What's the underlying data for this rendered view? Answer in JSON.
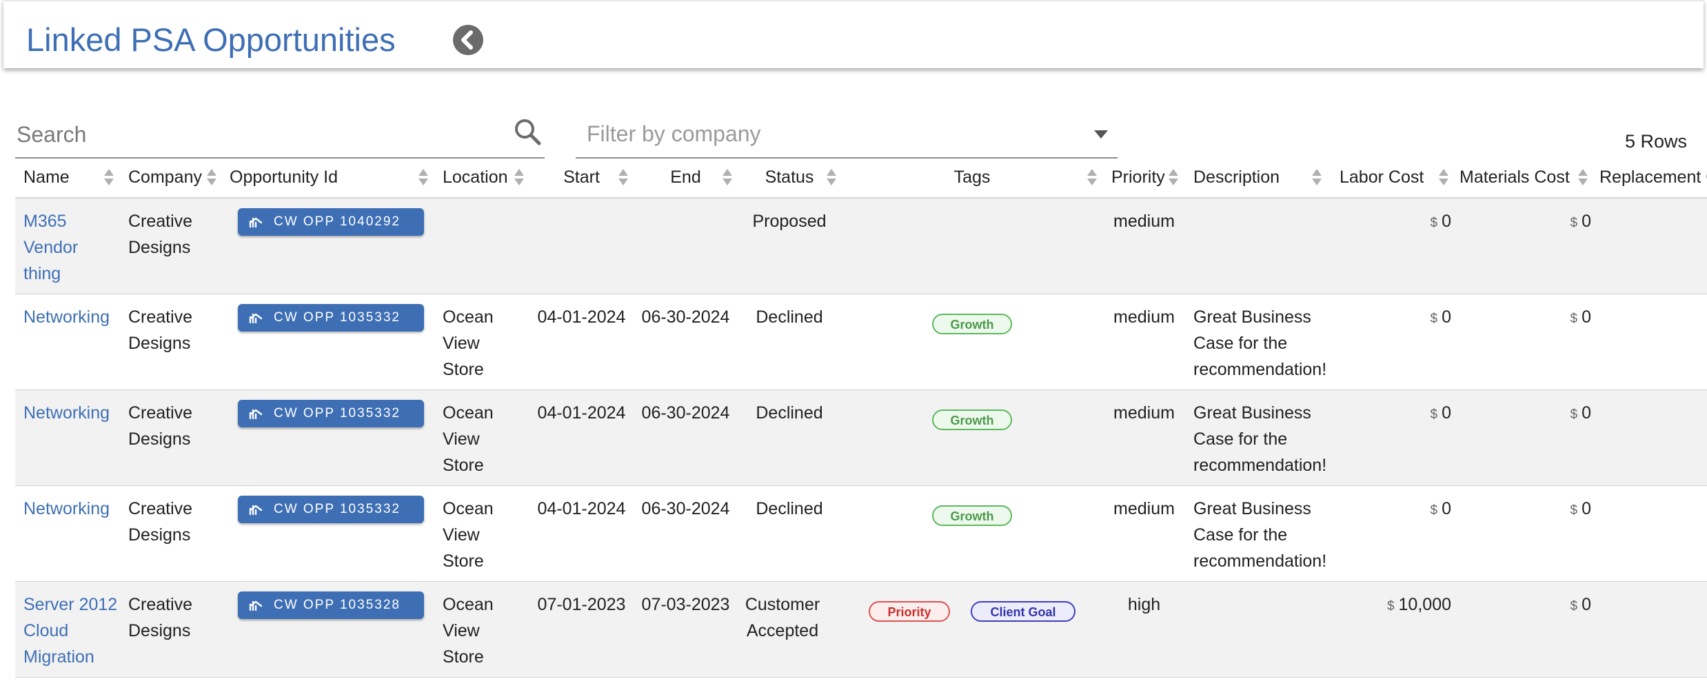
{
  "header": {
    "title": "Linked PSA Opportunities"
  },
  "search": {
    "placeholder": "Search",
    "value": ""
  },
  "filter": {
    "placeholder": "Filter by company"
  },
  "rows_count": "5 Rows",
  "columns": {
    "name": "Name",
    "company": "Company",
    "opportunity_id": "Opportunity Id",
    "location": "Location",
    "start": "Start",
    "end": "End",
    "status": "Status",
    "tags": "Tags",
    "priority": "Priority",
    "description": "Description",
    "labor_cost": "Labor Cost",
    "materials_cost": "Materials Cost",
    "replacement_cost": "Replacement Co"
  },
  "currency_symbol": "$",
  "rows": [
    {
      "name": "M365 Vendor thing",
      "company": "Creative Designs",
      "opportunity": "CW OPP 1040292",
      "location": "",
      "start": "",
      "end": "",
      "status": "Proposed",
      "tags": [],
      "priority": "medium",
      "description": "",
      "labor_cost": "0",
      "materials_cost": "0"
    },
    {
      "name": "Networking",
      "company": "Creative Designs",
      "opportunity": "CW OPP 1035332",
      "location": "Ocean View Store",
      "start": "04-01-2024",
      "end": "06-30-2024",
      "status": "Declined",
      "tags": [
        "Growth"
      ],
      "priority": "medium",
      "description": "Great Business Case for the recommendation!",
      "labor_cost": "0",
      "materials_cost": "0"
    },
    {
      "name": "Networking",
      "company": "Creative Designs",
      "opportunity": "CW OPP 1035332",
      "location": "Ocean View Store",
      "start": "04-01-2024",
      "end": "06-30-2024",
      "status": "Declined",
      "tags": [
        "Growth"
      ],
      "priority": "medium",
      "description": "Great Business Case for the recommendation!",
      "labor_cost": "0",
      "materials_cost": "0"
    },
    {
      "name": "Networking",
      "company": "Creative Designs",
      "opportunity": "CW OPP 1035332",
      "location": "Ocean View Store",
      "start": "04-01-2024",
      "end": "06-30-2024",
      "status": "Declined",
      "tags": [
        "Growth"
      ],
      "priority": "medium",
      "description": "Great Business Case for the recommendation!",
      "labor_cost": "0",
      "materials_cost": "0"
    },
    {
      "name": "Server 2012 Cloud Migration",
      "company": "Creative Designs",
      "opportunity": "CW OPP 1035328",
      "location": "Ocean View Store",
      "start": "07-01-2023",
      "end": "07-03-2023",
      "status": "Customer Accepted",
      "tags": [
        "Priority",
        "Client Goal"
      ],
      "priority": "high",
      "description": "",
      "labor_cost": "10,000",
      "materials_cost": "0"
    }
  ],
  "colors": {
    "accent": "#3e6fb5",
    "tag_growth": "#5cb85c",
    "tag_priority": "#d9534f",
    "tag_client_goal": "#3f3fbf"
  },
  "icons": {
    "back": "chevron-left-circle-icon",
    "search": "magnifier-icon",
    "filter_caret": "caret-down-icon",
    "opportunity_chip": "handshake-icon"
  }
}
